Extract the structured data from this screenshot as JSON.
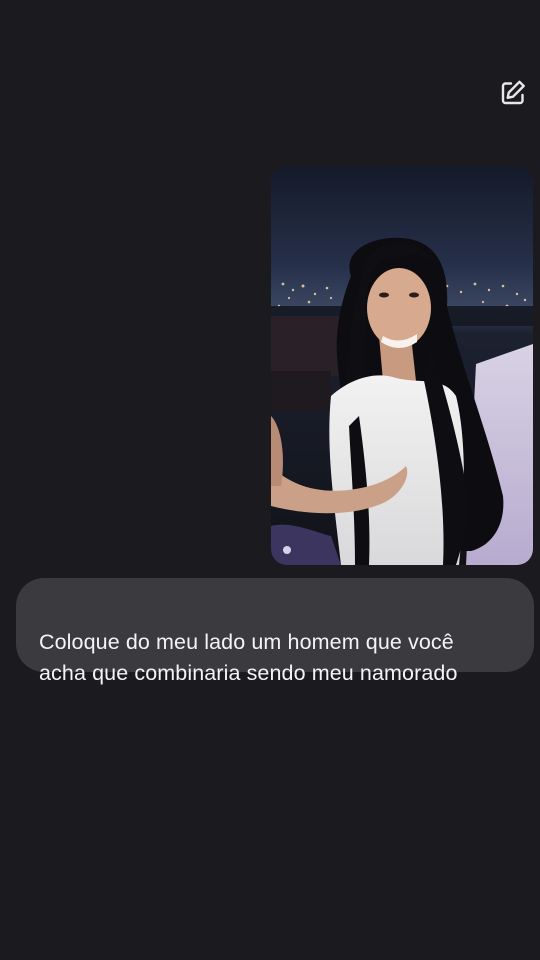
{
  "header": {
    "edit_icon": "compose-edit-icon",
    "edit_label": "Edit"
  },
  "conversation": {
    "image_message": {
      "icon": "photo-thumbnail",
      "description_hidden": true
    },
    "text_message": "Coloque do meu lado um homem que você\nacha que combinaria sendo meu namorado"
  },
  "colors": {
    "background": "#1b1b1f",
    "bubble": "#3a3a3f",
    "text": "#f4f4f6",
    "icon": "#e8e8ea"
  }
}
